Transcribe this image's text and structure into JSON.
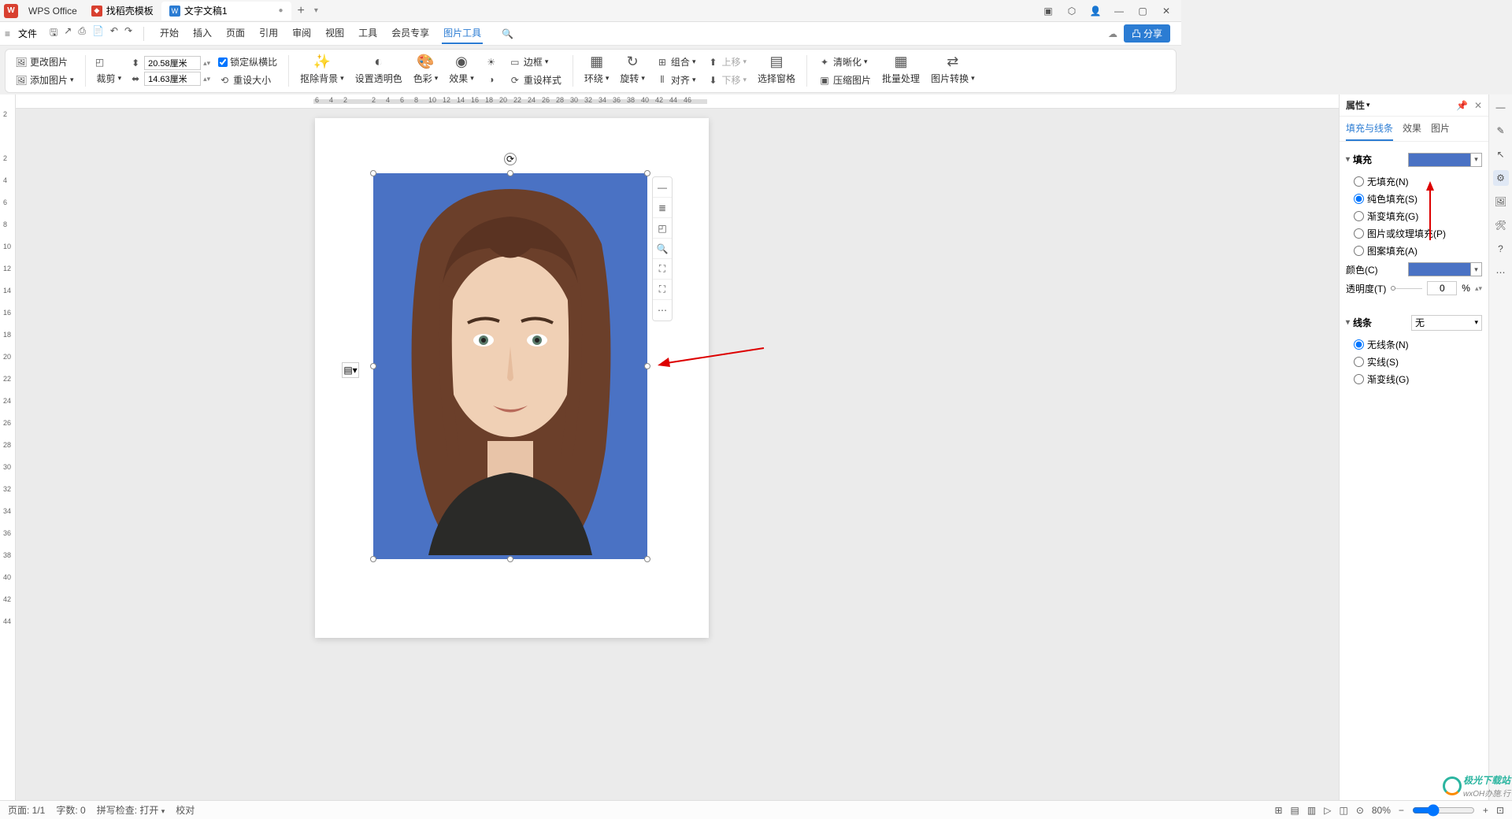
{
  "app": {
    "name": "WPS Office"
  },
  "tabs": [
    {
      "label": "找稻壳模板",
      "icon": "red"
    },
    {
      "label": "文字文稿1",
      "icon": "blue",
      "active": true
    }
  ],
  "window_controls": {
    "min": "—",
    "restore": "▢",
    "close": "✕"
  },
  "menubar": {
    "file": "文件",
    "tabs": [
      "开始",
      "插入",
      "页面",
      "引用",
      "审阅",
      "视图",
      "工具",
      "会员专享",
      "图片工具"
    ],
    "active_tab": "图片工具",
    "share": "分享"
  },
  "ribbon": {
    "change_pic": "更改图片",
    "add_pic": "添加图片",
    "crop": "裁剪",
    "width": "20.58厘米",
    "height": "14.63厘米",
    "lock_ratio": "锁定纵横比",
    "reset_size": "重设大小",
    "remove_bg": "抠除背景",
    "set_transparent": "设置透明色",
    "color": "色彩",
    "effect": "效果",
    "border": "边框",
    "reset_style": "重设样式",
    "wrap": "环绕",
    "rotate": "旋转",
    "combine": "组合",
    "align": "对齐",
    "move_up": "上移",
    "move_down": "下移",
    "select_pane": "选择窗格",
    "sharpen": "清晰化",
    "compress": "压缩图片",
    "batch": "批量处理",
    "convert": "图片转换"
  },
  "ruler_h": [
    "6",
    "4",
    "2",
    "",
    "2",
    "4",
    "6",
    "8",
    "10",
    "12",
    "14",
    "16",
    "18",
    "20",
    "22",
    "24",
    "26",
    "28",
    "30",
    "32",
    "34",
    "36",
    "38",
    "40",
    "42",
    "44",
    "46"
  ],
  "ruler_v": [
    "2",
    "",
    "2",
    "4",
    "6",
    "8",
    "10",
    "12",
    "14",
    "16",
    "18",
    "20",
    "22",
    "24",
    "26",
    "28",
    "30",
    "32",
    "34",
    "36",
    "38",
    "40",
    "42",
    "44"
  ],
  "panel": {
    "title": "属性",
    "tabs": [
      "填充与线条",
      "效果",
      "图片"
    ],
    "active_tab": "填充与线条",
    "fill_section": "填充",
    "fill_options": {
      "none": "无填充(N)",
      "solid": "纯色填充(S)",
      "gradient": "渐变填充(G)",
      "picture": "图片或纹理填充(P)",
      "pattern": "图案填充(A)"
    },
    "fill_selected": "solid",
    "color_label": "颜色(C)",
    "opacity_label": "透明度(T)",
    "opacity_value": "0",
    "opacity_unit": "%",
    "line_section": "线条",
    "line_type": "无",
    "line_options": {
      "none": "无线条(N)",
      "solid": "实线(S)",
      "gradient": "渐变线(G)"
    },
    "line_selected": "none"
  },
  "statusbar": {
    "page": "页面: 1/1",
    "words": "字数: 0",
    "spell": "拼写检查: 打开",
    "proof": "校对",
    "zoom": "80%"
  },
  "watermark": {
    "text": "极光下载站",
    "sub": "wxOH办施.行"
  }
}
